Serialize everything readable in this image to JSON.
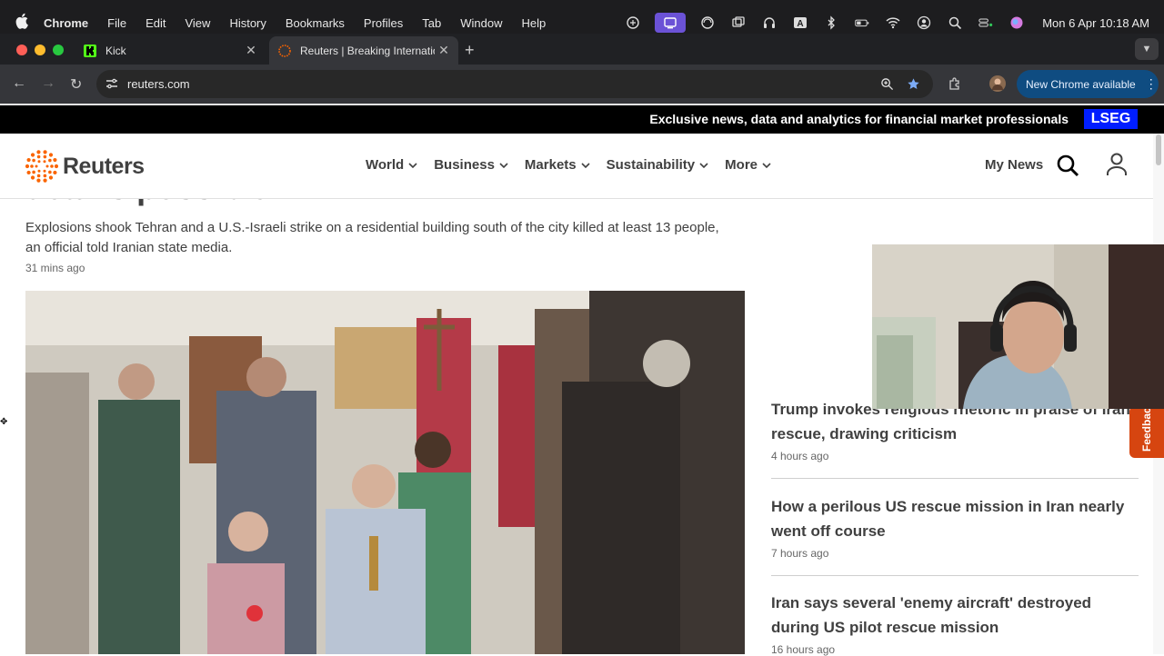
{
  "menubar": {
    "app_name": "Chrome",
    "menus": [
      "File",
      "Edit",
      "View",
      "History",
      "Bookmarks",
      "Profiles",
      "Tab",
      "Window",
      "Help"
    ],
    "clock": "Mon 6 Apr  10:18 AM"
  },
  "tabs": [
    {
      "title": "Kick",
      "favicon": "kick-logo-icon",
      "active": false
    },
    {
      "title": "Reuters | Breaking International",
      "favicon": "reuters-logo-icon",
      "active": true
    }
  ],
  "address_bar": {
    "url": "reuters.com"
  },
  "toolbar": {
    "update_button": "New Chrome available"
  },
  "banner": {
    "text": "Exclusive news, data and analytics for financial market professionals",
    "brand": "LSEG"
  },
  "site": {
    "logo_text": "Reuters",
    "nav": [
      "World",
      "Business",
      "Markets",
      "Sustainability",
      "More"
    ],
    "my_news": "My News"
  },
  "article": {
    "headline_visible": "deal is possible",
    "summary": "Explosions shook Tehran and a U.S.-Israeli strike on a residential building south of the city killed at least 13 people, an official told Iranian state media.",
    "time": "31 mins ago"
  },
  "sidebar_stories": [
    {
      "headline": "Trump invokes religious rhetoric in praise of Iran rescue, drawing criticism",
      "time": "4 hours ago"
    },
    {
      "headline": "How a perilous US rescue mission in Iran nearly went off course",
      "time": "7 hours ago"
    },
    {
      "headline": "Iran says several 'enemy aircraft' destroyed during US pilot rescue mission",
      "time": "16 hours ago"
    }
  ],
  "feedback_tab": "Feedback",
  "colors": {
    "lseg_blue": "#001eff",
    "reuters_orange": "#fa6400",
    "feedback": "#d64510"
  }
}
